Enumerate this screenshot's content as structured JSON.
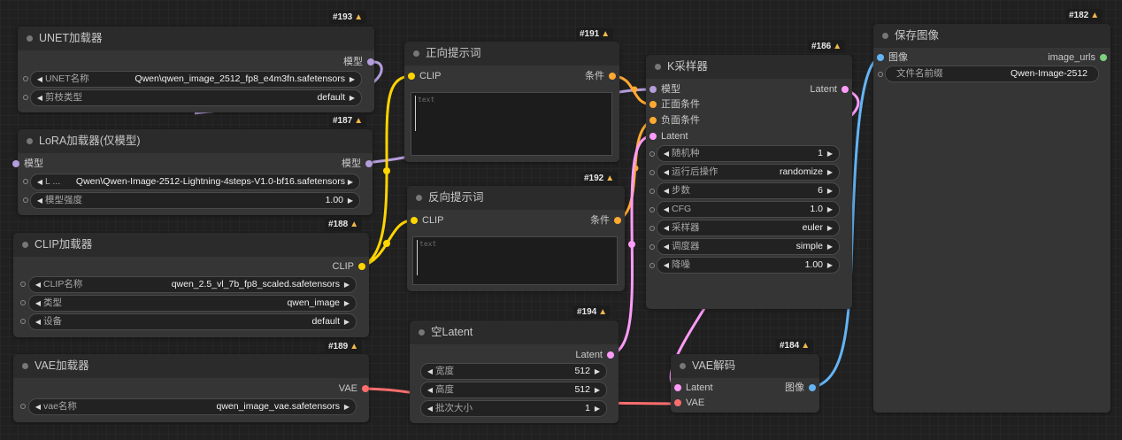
{
  "colors": {
    "canvas_bg": "#202020",
    "node_bg": "#353535",
    "title_bg": "#2b2b2b",
    "model": "#b39ddb",
    "clip": "#ffd500",
    "conditioning": "#ffa931",
    "latent": "#ff9cf9",
    "vae": "#ff6e6e",
    "image": "#64b5f6",
    "string": "#7ed27e",
    "badge_icon": "#f2b84b"
  },
  "nodes": {
    "unet": {
      "badge": "#193",
      "title": "UNET加载器",
      "out_model": "模型",
      "w_name_label": "UNET名称",
      "w_name_value": "Qwen\\qwen_image_2512_fp8_e4m3fn.safetensors",
      "w_prune_label": "剪枝类型",
      "w_prune_value": "default"
    },
    "lora": {
      "badge": "#187",
      "title": "LoRA加载器(仅模型)",
      "in_model": "模型",
      "out_model": "模型",
      "w_name_label": "L ...",
      "w_name_value": "Qwen\\Qwen-Image-2512-Lightning-4steps-V1.0-bf16.safetensors",
      "w_strength_label": "模型强度",
      "w_strength_value": "1.00"
    },
    "clip": {
      "badge": "#188",
      "title": "CLIP加载器",
      "out_clip": "CLIP",
      "w_name_label": "CLIP名称",
      "w_name_value": "qwen_2.5_vl_7b_fp8_scaled.safetensors",
      "w_type_label": "类型",
      "w_type_value": "qwen_image",
      "w_device_label": "设备",
      "w_device_value": "default"
    },
    "vae": {
      "badge": "#189",
      "title": "VAE加载器",
      "out_vae": "VAE",
      "w_name_label": "vae名称",
      "w_name_value": "qwen_image_vae.safetensors"
    },
    "pos": {
      "badge": "#191",
      "title": "正向提示词",
      "in_clip": "CLIP",
      "out_cond": "条件",
      "placeholder": "text"
    },
    "neg": {
      "badge": "#192",
      "title": "反向提示词",
      "in_clip": "CLIP",
      "out_cond": "条件",
      "placeholder": "text"
    },
    "latent": {
      "badge": "#194",
      "title": "空Latent",
      "out_latent": "Latent",
      "w_width_label": "宽度",
      "w_width_value": "512",
      "w_height_label": "高度",
      "w_height_value": "512",
      "w_batch_label": "批次大小",
      "w_batch_value": "1"
    },
    "ksampler": {
      "badge": "#186",
      "title": "K采样器",
      "in_model": "模型",
      "in_pos": "正面条件",
      "in_neg": "负面条件",
      "in_latent": "Latent",
      "out_latent": "Latent",
      "w_seed_label": "随机种",
      "w_seed_value": "1",
      "w_after_label": "运行后操作",
      "w_after_value": "randomize",
      "w_steps_label": "步数",
      "w_steps_value": "6",
      "w_cfg_label": "CFG",
      "w_cfg_value": "1.0",
      "w_sampler_label": "采样器",
      "w_sampler_value": "euler",
      "w_scheduler_label": "调度器",
      "w_scheduler_value": "simple",
      "w_denoise_label": "降噪",
      "w_denoise_value": "1.00"
    },
    "vaedecode": {
      "badge": "#184",
      "title": "VAE解码",
      "in_latent": "Latent",
      "in_vae": "VAE",
      "out_image": "图像"
    },
    "save": {
      "badge": "#182",
      "title": "保存图像",
      "in_image": "图像",
      "out_urls": "image_urls",
      "w_prefix_label": "文件名前缀",
      "w_prefix_value": "Qwen-Image-2512"
    }
  }
}
